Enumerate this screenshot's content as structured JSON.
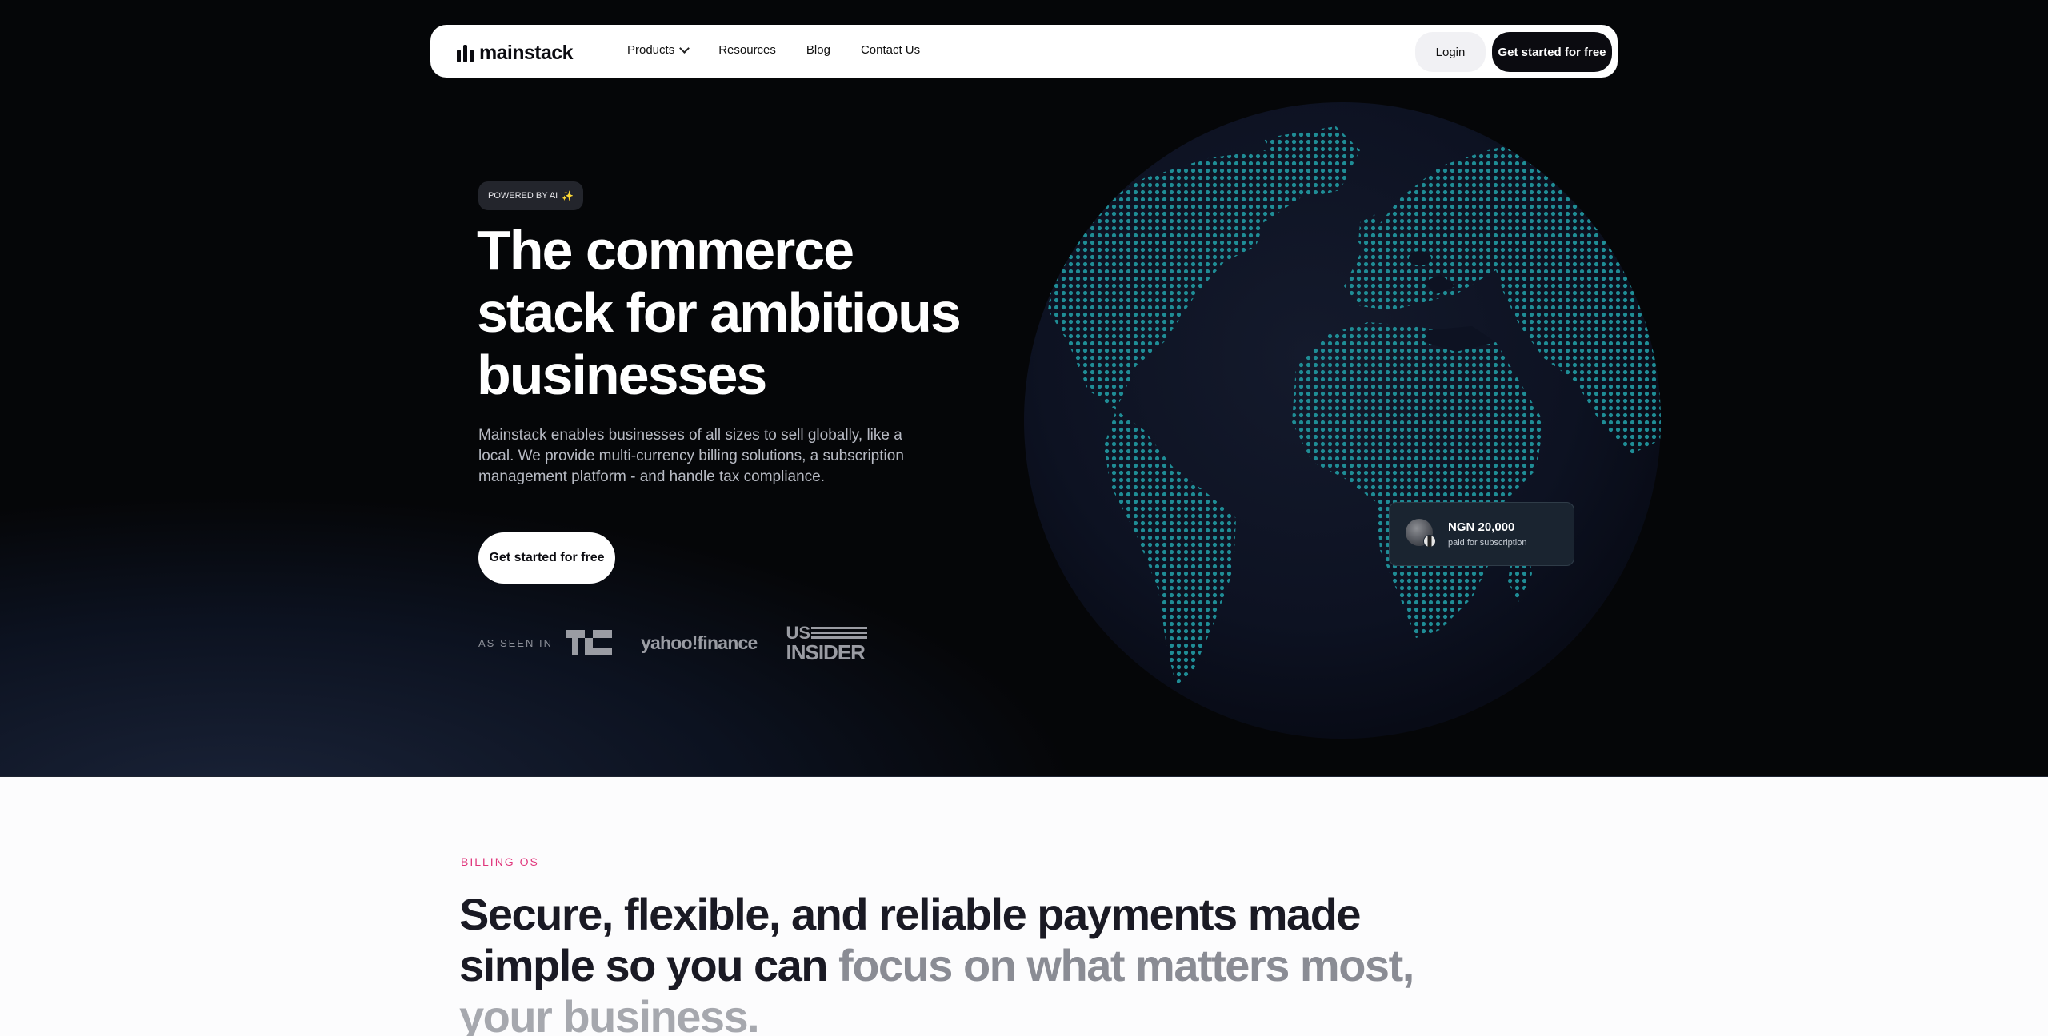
{
  "nav": {
    "logo_text": "mainstack",
    "links": [
      "Products",
      "Resources",
      "Blog",
      "Contact Us"
    ],
    "login_label": "Login",
    "cta_label": "Get started for free"
  },
  "hero": {
    "badge": "POWERED BY AI",
    "badge_icon": "sparkle-icon",
    "title_lines": [
      "The commerce",
      "stack for ambitious",
      "businesses"
    ],
    "description": "Mainstack enables businesses of all sizes to sell globally, like a local. We provide multi-currency billing solutions, a subscription management platform - and handle tax compliance.",
    "cta_label": "Get started for free",
    "seen_in_label": "AS SEEN IN",
    "press": {
      "techcrunch": "TC",
      "yahoo": "yahoo!finance",
      "insider_us": "US",
      "insider_name": "INSIDER"
    }
  },
  "payment_card": {
    "amount": "NGN 20,000",
    "subtitle": "paid for subscription"
  },
  "section2": {
    "eyebrow": "BILLING OS",
    "line1": "Secure, flexible, and reliable payments made",
    "line2_dark": "simple so you can ",
    "line2_muted": "focus on what matters most,",
    "line3_muted": "your business."
  },
  "colors": {
    "hero_bg": "#050608",
    "globe_dots": "#1f8d96",
    "accent_pink": "#e0357b",
    "text_dark": "#1a1a24"
  }
}
